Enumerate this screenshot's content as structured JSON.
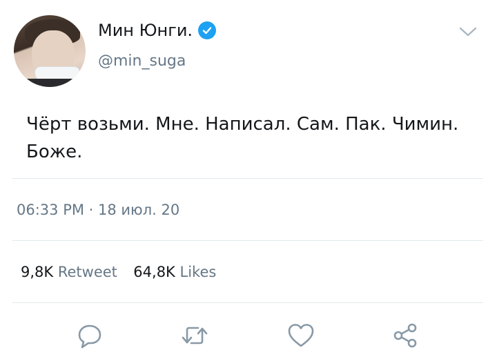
{
  "author": {
    "display_name": "Мин Юнги.",
    "username": "@min_suga",
    "verified": true
  },
  "tweet": {
    "text_line1": "Чёрт возьми. Мне. Написал. Сам. Пак. Чимин.",
    "text_line2": "Боже.",
    "timestamp": "06:33 PM · 18 июл. 20"
  },
  "stats": {
    "retweets_count": "9,8K",
    "retweets_label": "Retweet",
    "likes_count": "64,8K",
    "likes_label": "Likes"
  },
  "icons": {
    "reply": "reply-icon",
    "retweet": "retweet-icon",
    "like": "heart-icon",
    "share": "share-icon",
    "more": "chevron-down-icon",
    "verified": "verified-badge-icon"
  },
  "colors": {
    "accent": "#1da1f2",
    "text": "#14171a",
    "secondary": "#657786",
    "icon": "#8899a6",
    "divider": "#e1e8ed"
  }
}
